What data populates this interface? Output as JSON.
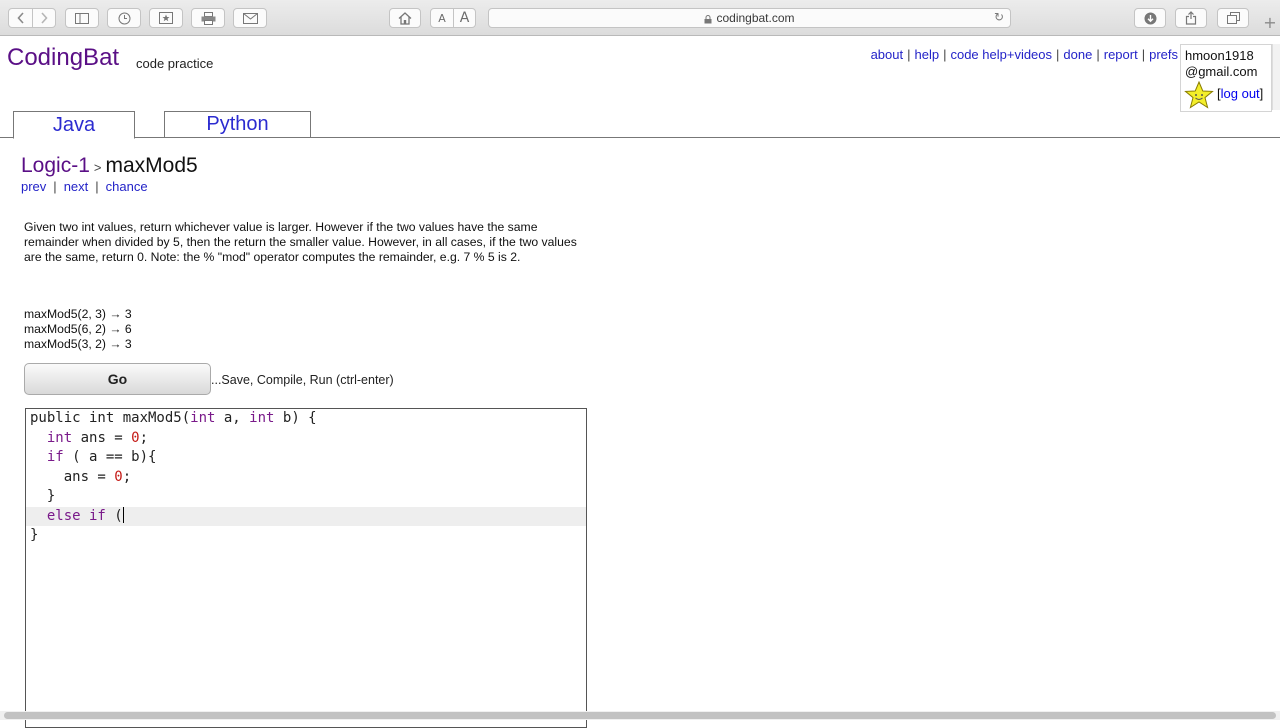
{
  "browser": {
    "url": "codingbat.com",
    "icons": [
      "back-icon",
      "forward-icon",
      "sidebar-icon",
      "history-icon",
      "bookmarks-icon",
      "print-icon",
      "mail-icon",
      "home-icon",
      "reload-icon",
      "download-icon",
      "share-icon",
      "tabs-icon",
      "new-tab-icon"
    ],
    "font_small": "A",
    "font_large": "A"
  },
  "site": {
    "logo": "CodingBat",
    "tagline": "code practice",
    "nav": [
      "about",
      "help",
      "code help+videos",
      "done",
      "report",
      "prefs"
    ],
    "user_line1": "hmoon1918",
    "user_line2": "@gmail.com",
    "logout": "log out",
    "logout_open": "[",
    "logout_close": "]"
  },
  "tabs": [
    {
      "label": "Java",
      "active": true
    },
    {
      "label": "Python",
      "active": false
    }
  ],
  "breadcrumb": {
    "section": "Logic-1",
    "separator": ">",
    "problem": "maxMod5"
  },
  "subnav": [
    "prev",
    "next",
    "chance"
  ],
  "description": "Given two int values, return whichever value is larger. However if the two values have the same remainder when divided by 5, then the return the smaller value. However, in all cases, if the two values are the same, return 0. Note: the % \"mod\" operator computes the remainder, e.g. 7 % 5 is 2.",
  "examples": [
    "maxMod5(2, 3) → 3",
    "maxMod5(6, 2) → 6",
    "maxMod5(3, 2) → 3"
  ],
  "go_button": "Go",
  "go_hint": "...Save, Compile, Run (ctrl-enter)",
  "code": {
    "l1_a": "public int maxMod5(",
    "l1_kw1": "int",
    "l1_b": " a, ",
    "l1_kw2": "int",
    "l1_c": " b) {",
    "l2_a": "  ",
    "l2_kw": "int",
    "l2_b": " ans = ",
    "l2_num": "0",
    "l2_c": ";",
    "l3_a": "  ",
    "l3_kw": "if",
    "l3_b": " ( a == b){",
    "l4_a": "    ans = ",
    "l4_num": "0",
    "l4_c": ";",
    "l5": "  }",
    "l6_a": "  ",
    "l6_kw": "else if",
    "l6_b": " (",
    "l7": "}"
  },
  "colors": {
    "brand": "#5a0f86",
    "link": "#2323c8"
  }
}
